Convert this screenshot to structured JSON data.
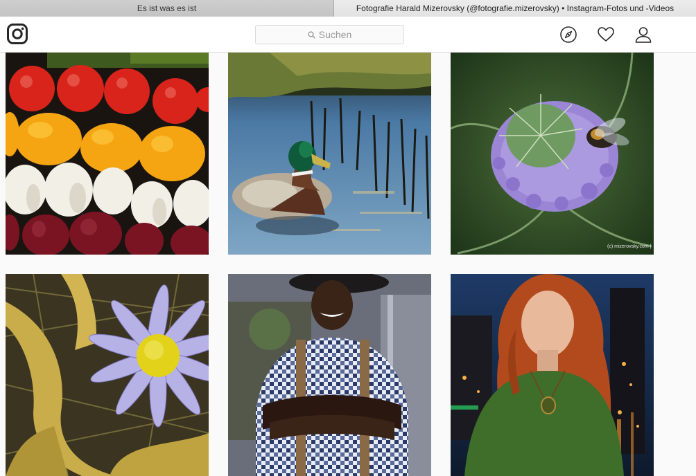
{
  "browser": {
    "tabs": [
      {
        "label": "Es ist was es ist",
        "active": false
      },
      {
        "label": "Fotografie Harald Mizerovsky (@fotografie.mizerovsky) • Instagram-Fotos und -Videos",
        "active": true
      }
    ]
  },
  "header": {
    "logo_icon": "instagram-camera-icon",
    "search": {
      "placeholder": "Suchen",
      "icon": "search-icon"
    },
    "nav_icons": [
      "compass-icon",
      "heart-icon",
      "user-icon"
    ]
  },
  "grid": {
    "posts": [
      {
        "subject": "vegetables"
      },
      {
        "subject": "duck"
      },
      {
        "subject": "thistle-bee",
        "watermark": "(c) mizerovsky.com |"
      },
      {
        "subject": "aster-flower"
      },
      {
        "subject": "man-portrait"
      },
      {
        "subject": "woman-portrait"
      }
    ]
  },
  "colors": {
    "border": "#dbdbdb",
    "background": "#fafafa",
    "header_bg": "#ffffff",
    "icon": "#262626"
  }
}
